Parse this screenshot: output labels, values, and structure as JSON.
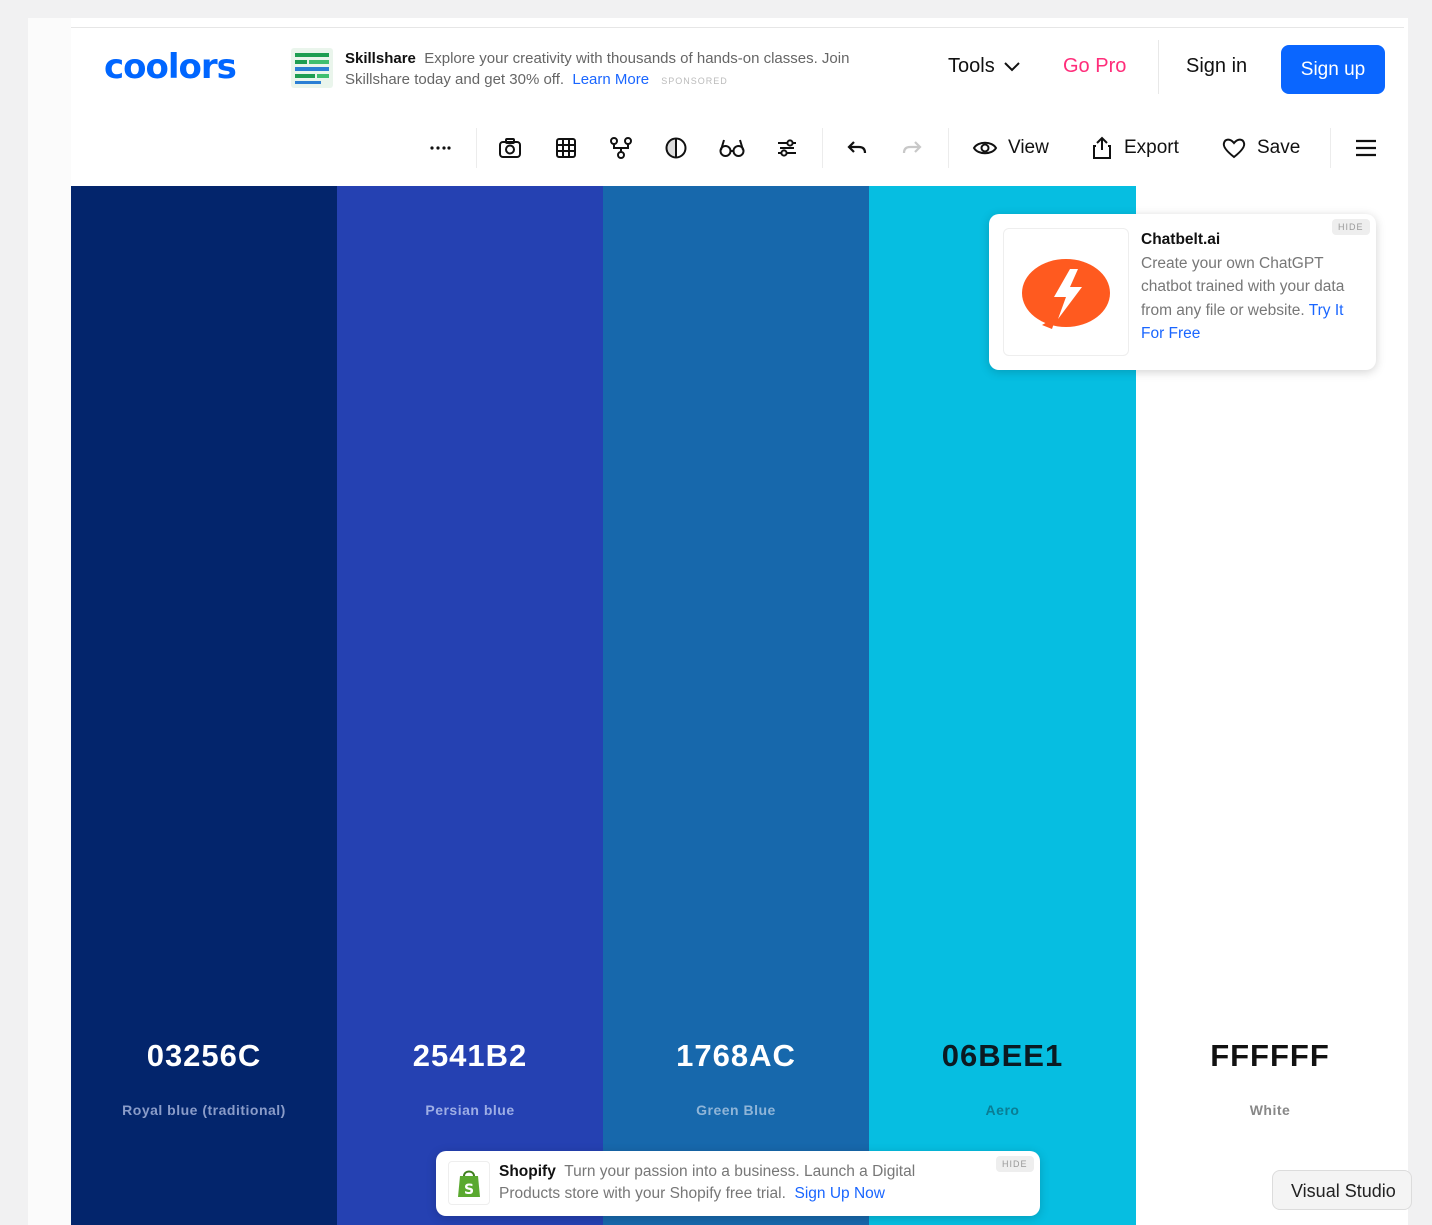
{
  "brand": {
    "logo_text": "coolors"
  },
  "sponsored_banner": {
    "brand": "Skillshare",
    "text": "Explore your creativity with thousands of hands-on classes. Join Skillshare today and get 30% off.",
    "link": "Learn More",
    "tag": "SPONSORED"
  },
  "nav": {
    "tools": "Tools",
    "gopro": "Go Pro",
    "signin": "Sign in",
    "signup": "Sign up"
  },
  "toolbar": {
    "more_icon": "ellipsis-icon",
    "view": "View",
    "export": "Export",
    "save": "Save"
  },
  "palette": [
    {
      "hex": "03256C",
      "name": "Royal blue (traditional)",
      "color": "#03256C",
      "text_color": "#ffffff",
      "sub_color": "#8a9cc9"
    },
    {
      "hex": "2541B2",
      "name": "Persian blue",
      "color": "#2541B2",
      "text_color": "#ffffff",
      "sub_color": "#9eaee5"
    },
    {
      "hex": "1768AC",
      "name": "Green Blue",
      "color": "#1768AC",
      "text_color": "#ffffff",
      "sub_color": "#8fb5d8"
    },
    {
      "hex": "06BEE1",
      "name": "Aero",
      "color": "#06BEE1",
      "text_color": "#0b1a22",
      "sub_color": "#0a7d94"
    },
    {
      "hex": "FFFFFF",
      "name": "White",
      "color": "#FFFFFF",
      "text_color": "#111111",
      "sub_color": "#888888"
    }
  ],
  "chat_ad": {
    "title": "Chatbelt.ai",
    "text": "Create your own ChatGPT chatbot trained with your data from any file or website.",
    "link": "Try It For Free",
    "hide": "HIDE"
  },
  "shopify_ad": {
    "brand": "Shopify",
    "text": "Turn your passion into a business. Launch a Digital Products store with your Shopify free trial.",
    "link": "Sign Up Now",
    "hide": "HIDE"
  },
  "corner_popup": {
    "label": "Visual Studio"
  }
}
